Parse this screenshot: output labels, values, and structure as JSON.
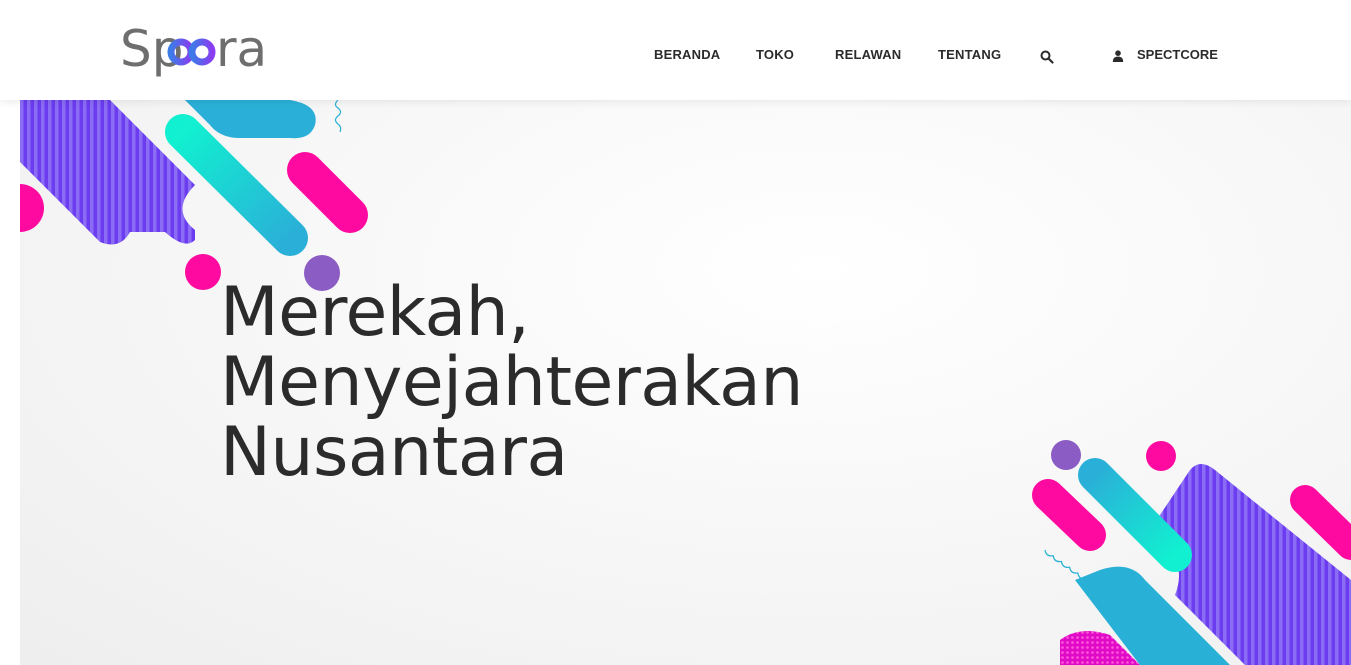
{
  "brand": {
    "name": "Spora",
    "text_before": "Sp",
    "text_after": "ra",
    "colors": {
      "text": "#6e6e6e",
      "o_left": "#3c7be8",
      "o_right": "#8a3df0"
    }
  },
  "nav": {
    "items": [
      {
        "label": "BERANDA"
      },
      {
        "label": "TOKO"
      },
      {
        "label": "RELAWAN"
      },
      {
        "label": "TENTANG"
      }
    ],
    "search_icon": "search-icon",
    "user": {
      "icon": "user-icon",
      "label": "SPECTCORE"
    }
  },
  "hero": {
    "headline": [
      "Merekah,",
      "Menyejahterakan",
      "Nusantara"
    ],
    "colors": {
      "pink": "#ff0aa0",
      "cyan": "#19d6d0",
      "teal": "#29b0d6",
      "purple": "#8a5cc4",
      "violet": "#6b3cf0"
    }
  }
}
